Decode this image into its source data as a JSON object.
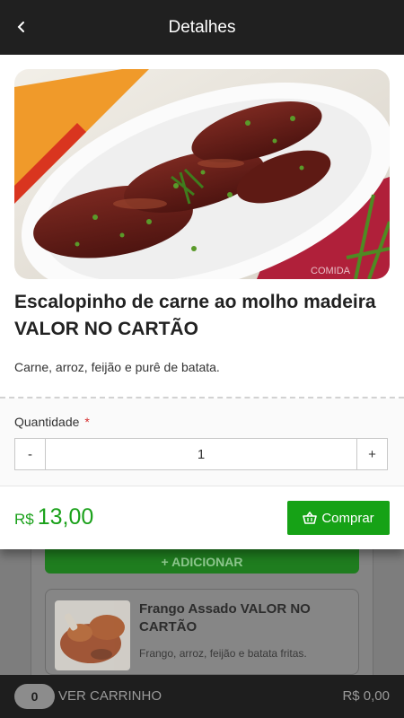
{
  "header": {
    "back_icon": "chevron-left-icon",
    "title": "Detalhes"
  },
  "dish": {
    "name": "Escalopinho de carne ao molho madeira VALOR NO CARTÃO",
    "description": "Carne, arroz, feijão e purê de batata.",
    "image_watermark": "COMIDA"
  },
  "quantity": {
    "label": "Quantidade",
    "required_marker": "*",
    "value": "1",
    "minus_label": "-",
    "plus_label": "+"
  },
  "footer": {
    "currency": "R$",
    "price": "13,00",
    "buy_label": "Comprar",
    "buy_icon": "basket-icon"
  },
  "background": {
    "add_label": "+ ADICIONAR",
    "item_title": "Frango Assado VALOR NO CARTÃO",
    "item_desc": "Frango, arroz, feijão e batata fritas."
  },
  "cart": {
    "count": "0",
    "label": "VER CARRINHO",
    "total": "R$ 0,00"
  },
  "colors": {
    "accent_green": "#16a216",
    "topbar": "#202020",
    "required_red": "#d62f2f"
  }
}
